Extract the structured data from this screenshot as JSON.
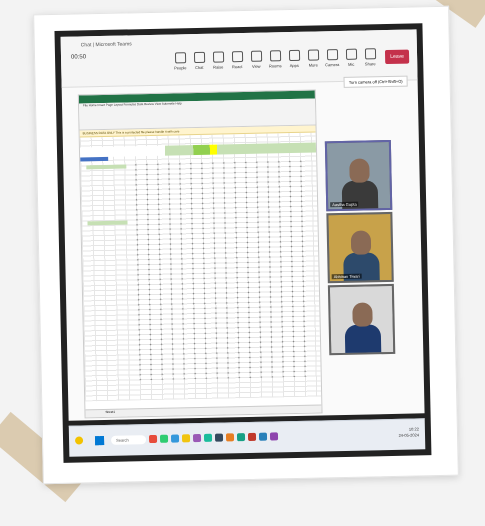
{
  "teams": {
    "window_title": "Chat | Microsoft Teams",
    "timer": "00:50",
    "toolbar": [
      {
        "label": "People",
        "icon": "people-icon"
      },
      {
        "label": "Chat",
        "icon": "chat-icon"
      },
      {
        "label": "Raise",
        "icon": "raise-hand-icon"
      },
      {
        "label": "React",
        "icon": "react-icon"
      },
      {
        "label": "View",
        "icon": "view-icon"
      },
      {
        "label": "Rooms",
        "icon": "rooms-icon"
      },
      {
        "label": "Apps",
        "icon": "apps-icon"
      },
      {
        "label": "More",
        "icon": "more-icon"
      },
      {
        "label": "Camera",
        "icon": "camera-icon"
      },
      {
        "label": "Mic",
        "icon": "mic-icon"
      },
      {
        "label": "Share",
        "icon": "share-icon"
      }
    ],
    "leave_label": "Leave",
    "tooltip": "Turn camera off (Ctrl+Shift+O)"
  },
  "excel": {
    "tabs_text": "File  Home  Insert  Page Layout  Formulas  Data  Review  View  Automate  Help",
    "banner_text": "BUSINESS DATA ONLY This is a protected file please handle it with care",
    "sheet_tab": "Sheet1"
  },
  "participants": [
    {
      "name": "Aastha Gupta",
      "active": true,
      "bg": "#8a9aa5",
      "shirt": "#3a3a3a"
    },
    {
      "name": "Abhinav Tiwari",
      "active": false,
      "bg": "#c8a24a",
      "shirt": "#2d4a6b"
    },
    {
      "name": "",
      "active": false,
      "bg": "#d9d9d9",
      "shirt": "#1e3a6e"
    }
  ],
  "taskbar": {
    "search_placeholder": "Search",
    "time": "10:22",
    "date": "24-05-2024",
    "app_colors": [
      "#e74c3c",
      "#2ecc71",
      "#3498db",
      "#f1c40f",
      "#9b59b6",
      "#1abc9c",
      "#34495e",
      "#e67e22",
      "#16a085",
      "#c0392b",
      "#2980b9",
      "#8e44ad"
    ]
  }
}
